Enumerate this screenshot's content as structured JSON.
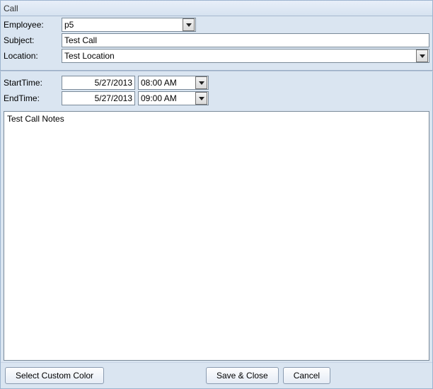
{
  "title": "Call",
  "labels": {
    "employee": "Employee:",
    "subject": "Subject:",
    "location": "Location:",
    "startTime": "StartTime:",
    "endTime": "EndTime:"
  },
  "values": {
    "employee": "p5",
    "subject": "Test Call",
    "location": "Test Location",
    "startDate": "5/27/2013",
    "startTime": "08:00 AM",
    "endDate": "5/27/2013",
    "endTime": "09:00 AM",
    "notes": "Test Call Notes"
  },
  "buttons": {
    "selectColor": "Select Custom Color",
    "saveClose": "Save & Close",
    "cancel": "Cancel"
  }
}
